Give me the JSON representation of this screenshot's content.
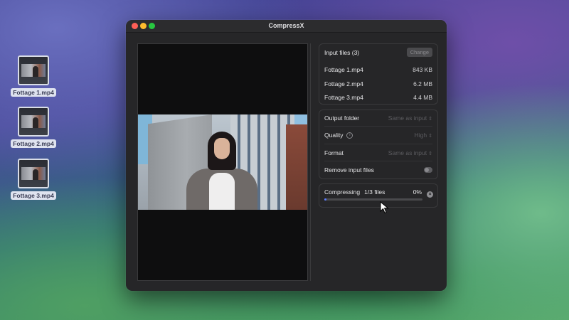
{
  "desktop": {
    "files": [
      {
        "label": "Fottage 1.mp4"
      },
      {
        "label": "Fottage 2.mp4"
      },
      {
        "label": "Fottage 3.mp4"
      }
    ]
  },
  "window": {
    "title": "CompressX"
  },
  "input": {
    "header": "Input files (3)",
    "change_label": "Change",
    "files": [
      {
        "name": "Fottage 1.mp4",
        "size": "843 KB"
      },
      {
        "name": "Fottage 2.mp4",
        "size": "6.2 MB"
      },
      {
        "name": "Fottage 3.mp4",
        "size": "4.4 MB"
      }
    ]
  },
  "settings": {
    "output_folder": {
      "label": "Output folder",
      "value": "Same as input"
    },
    "quality": {
      "label": "Quality",
      "value": "High"
    },
    "format": {
      "label": "Format",
      "value": "Same as input"
    },
    "remove_input": {
      "label": "Remove input files",
      "enabled": false
    }
  },
  "progress": {
    "status": "Compressing",
    "count": "1/3 files",
    "percent_label": "0%",
    "fraction": 0.0
  },
  "colors": {
    "accent": "#5b7cff"
  }
}
